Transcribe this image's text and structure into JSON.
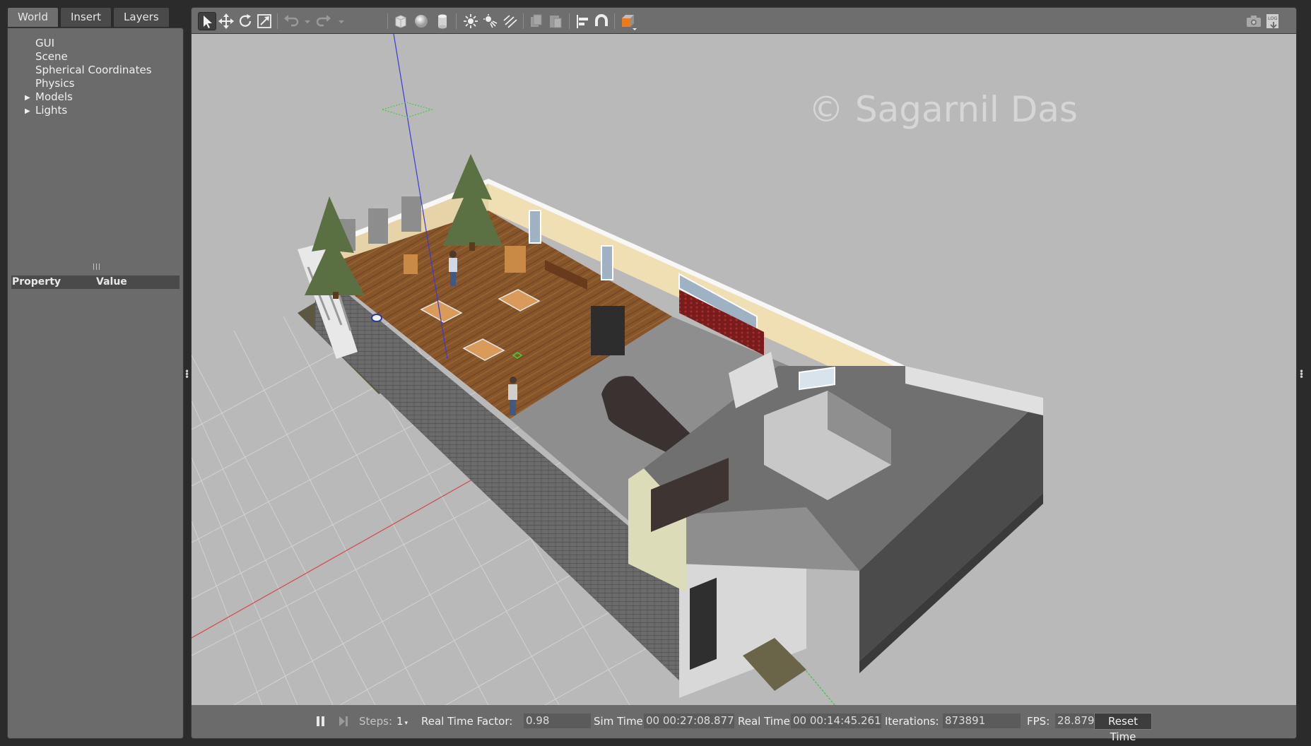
{
  "left_panel": {
    "tabs": [
      {
        "label": "World",
        "active": true
      },
      {
        "label": "Insert",
        "active": false
      },
      {
        "label": "Layers",
        "active": false
      }
    ],
    "tree": [
      {
        "label": "GUI",
        "expandable": false
      },
      {
        "label": "Scene",
        "expandable": false
      },
      {
        "label": "Spherical Coordinates",
        "expandable": false
      },
      {
        "label": "Physics",
        "expandable": false
      },
      {
        "label": "Models",
        "expandable": true
      },
      {
        "label": "Lights",
        "expandable": true
      }
    ],
    "properties": {
      "col_property": "Property",
      "col_value": "Value"
    }
  },
  "toolbar": {
    "buttons": [
      "select-arrow-icon",
      "translate-icon",
      "rotate-icon",
      "scale-icon",
      "undo-icon",
      "undo-history-icon",
      "redo-icon",
      "redo-history-icon",
      "box-icon",
      "sphere-icon",
      "cylinder-icon",
      "point-light-icon",
      "spot-light-icon",
      "directional-light-icon",
      "copy-icon",
      "paste-icon",
      "align-icon",
      "magnet-snap-icon",
      "view-angle-icon",
      "screenshot-icon",
      "log-icon"
    ]
  },
  "viewport": {
    "watermark": "© Sagarnil Das",
    "colors": {
      "background": "#b9b9b9",
      "floor_wood": "#8a5a2c",
      "wall_cream": "#f2dfb0",
      "wall_outer": "#5f5f5f"
    }
  },
  "bottom_bar": {
    "steps_label": "Steps:",
    "steps_value": "1",
    "rtf_label": "Real Time Factor:",
    "rtf_value": "0.98",
    "sim_time_label": "Sim Time:",
    "sim_time_value": "00 00:27:08.877",
    "real_time_label": "Real Time:",
    "real_time_value": "00 00:14:45.261",
    "iterations_label": "Iterations:",
    "iterations_value": "873891",
    "fps_label": "FPS:",
    "fps_value": "28.8798",
    "reset_label": "Reset Time"
  }
}
